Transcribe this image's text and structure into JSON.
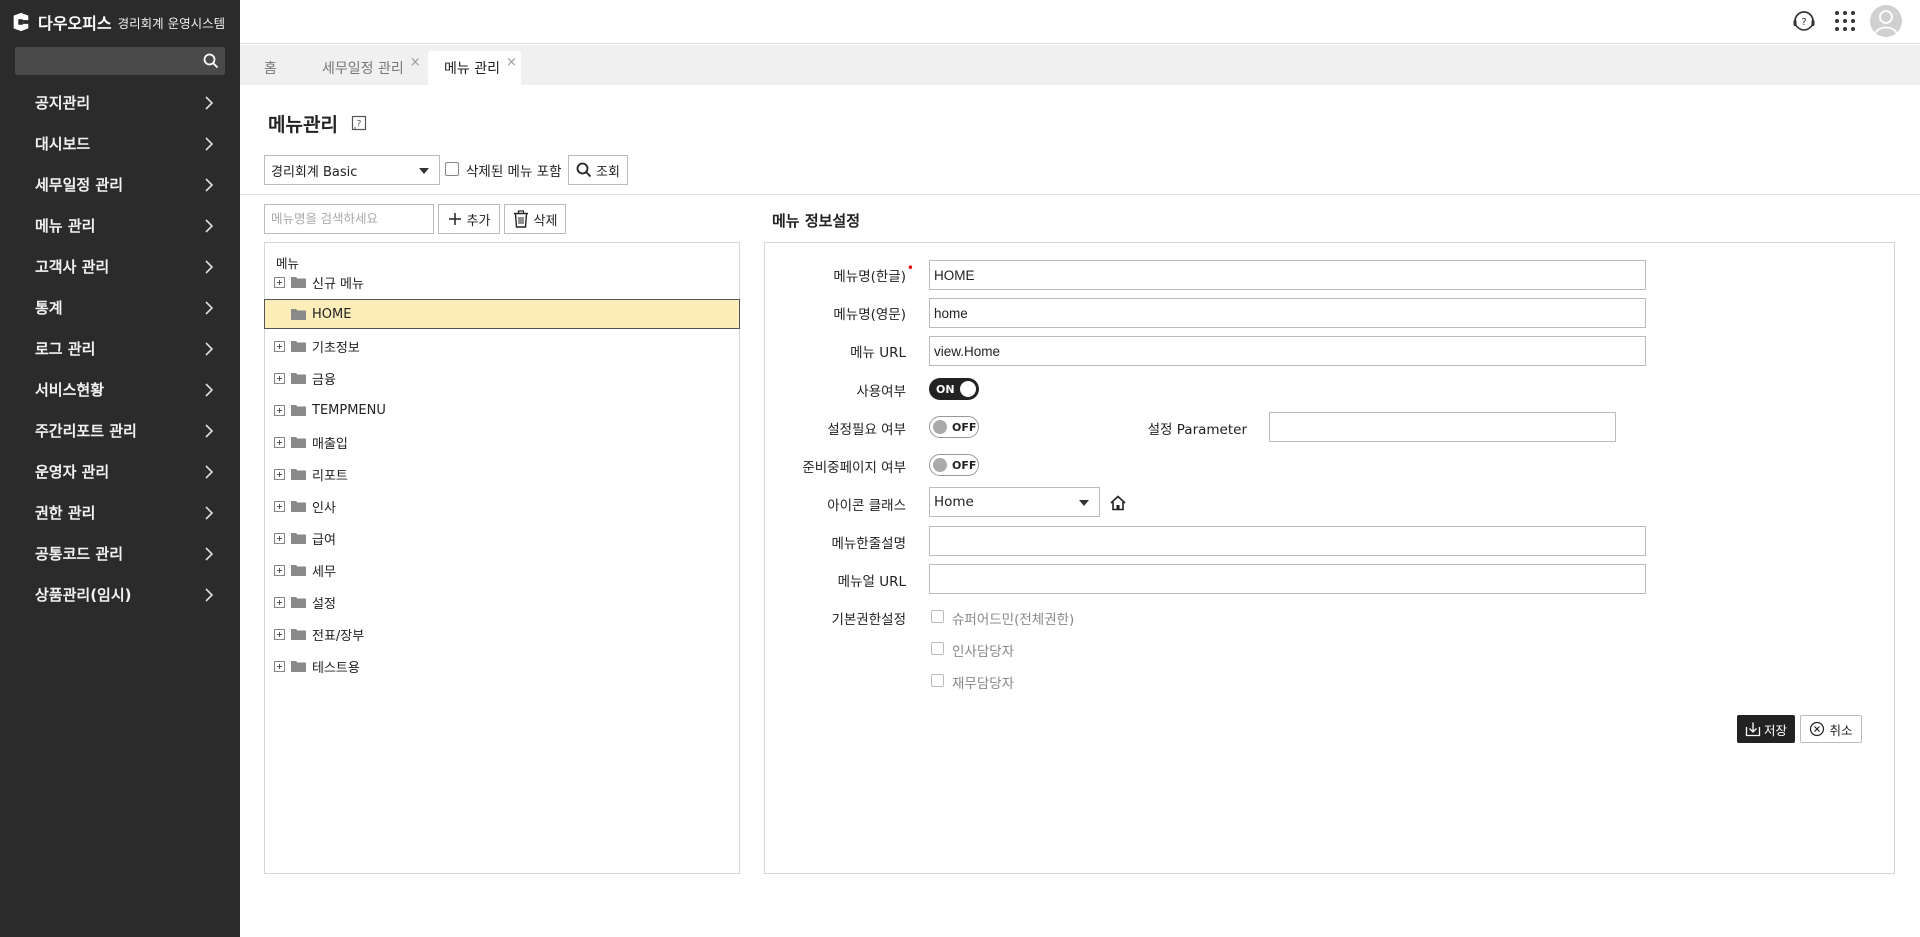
{
  "brand": {
    "name": "다우오피스",
    "subtitle": "경리회계 운영시스템"
  },
  "sidebar": {
    "search_placeholder": "",
    "items": [
      {
        "label": "공지관리"
      },
      {
        "label": "대시보드"
      },
      {
        "label": "세무일정 관리"
      },
      {
        "label": "메뉴 관리"
      },
      {
        "label": "고객사 관리"
      },
      {
        "label": "통계"
      },
      {
        "label": "로그 관리"
      },
      {
        "label": "서비스현황"
      },
      {
        "label": "주간리포트 관리"
      },
      {
        "label": "운영자 관리"
      },
      {
        "label": "권한 관리"
      },
      {
        "label": "공통코드 관리"
      },
      {
        "label": "상품관리(임시)"
      }
    ]
  },
  "tabs": [
    {
      "label": "홈"
    },
    {
      "label": "세무일정 관리",
      "close": "×"
    },
    {
      "label": "메뉴 관리",
      "close": "×"
    }
  ],
  "page": {
    "title": "메뉴관리",
    "filter_value": "경리회계 Basic",
    "include_deleted_label": "삭제된 메뉴 포함",
    "query_label": "조회"
  },
  "tree": {
    "search_placeholder": "메뉴명을 검색하세요",
    "add_label": "추가",
    "delete_label": "삭제",
    "root_label": "메뉴",
    "items": [
      {
        "label": "신규 메뉴"
      },
      {
        "label": "HOME"
      },
      {
        "label": "기초정보"
      },
      {
        "label": "금융"
      },
      {
        "label": "TEMPMENU"
      },
      {
        "label": "매출입"
      },
      {
        "label": "리포트"
      },
      {
        "label": "인사"
      },
      {
        "label": "급여"
      },
      {
        "label": "세무"
      },
      {
        "label": "설정"
      },
      {
        "label": "전표/장부"
      },
      {
        "label": "테스트용"
      }
    ]
  },
  "form": {
    "heading": "메뉴 정보설정",
    "name_ko_label": "메뉴명(한글)",
    "required_mark": "•",
    "name_ko_value": "HOME",
    "name_en_label": "메뉴명(영문)",
    "name_en_value": "home",
    "url_label": "메뉴 URL",
    "url_value": "view.Home",
    "use_label": "사용여부",
    "use_state": "ON",
    "setting_required_label": "설정필요 여부",
    "setting_required_state": "OFF",
    "setting_param_label": "설정 Parameter",
    "setting_param_value": "",
    "preparing_label": "준비중페이지 여부",
    "preparing_state": "OFF",
    "icon_class_label": "아이콘 클래스",
    "icon_class_value": "Home",
    "desc_label": "메뉴한줄설명",
    "desc_value": "",
    "help_url_label": "메뉴얼 URL",
    "help_url_value": "",
    "permission_label": "기본권한설정",
    "permissions": [
      {
        "label": "슈퍼어드민(전체권한)"
      },
      {
        "label": "인사담당자"
      },
      {
        "label": "재무담당자"
      }
    ],
    "save_label": "저장",
    "cancel_label": "취소"
  }
}
